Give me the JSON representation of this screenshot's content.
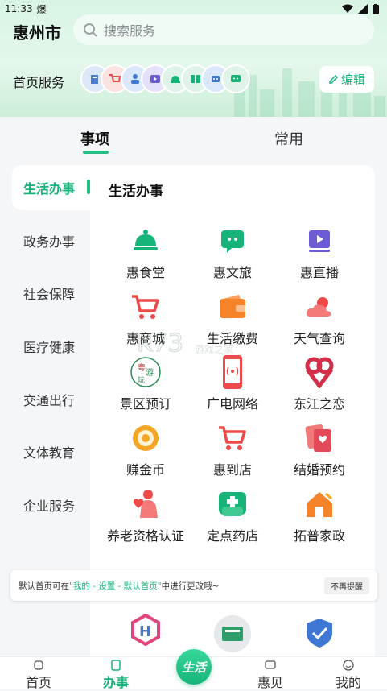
{
  "status": {
    "time": "11:33",
    "extra": "爆"
  },
  "header": {
    "city": "惠州市",
    "search_placeholder": "搜索服务",
    "home_services_label": "首页服务",
    "edit_label": "编辑"
  },
  "tabs": [
    {
      "label": "事项"
    },
    {
      "label": "常用"
    }
  ],
  "sidebar": [
    {
      "label": "生活办事"
    },
    {
      "label": "政务办事"
    },
    {
      "label": "社会保障"
    },
    {
      "label": "医疗健康"
    },
    {
      "label": "交通出行"
    },
    {
      "label": "文体教育"
    },
    {
      "label": "企业服务"
    }
  ],
  "panel": {
    "title": "生活办事"
  },
  "services": [
    {
      "label": "惠食堂",
      "icon": "dining-bell-icon"
    },
    {
      "label": "惠文旅",
      "icon": "chat-bubble-icon"
    },
    {
      "label": "惠直播",
      "icon": "play-icon"
    },
    {
      "label": "惠商城",
      "icon": "shopping-cart-icon"
    },
    {
      "label": "生活缴费",
      "icon": "wallet-icon"
    },
    {
      "label": "天气查询",
      "icon": "weather-icon"
    },
    {
      "label": "景区预订",
      "icon": "scenic-badge-icon"
    },
    {
      "label": "广电网络",
      "icon": "phone-signal-icon"
    },
    {
      "label": "东江之恋",
      "icon": "heart-ribbon-icon"
    },
    {
      "label": "赚金币",
      "icon": "coin-icon"
    },
    {
      "label": "惠到店",
      "icon": "store-cart-icon"
    },
    {
      "label": "结婚预约",
      "icon": "marriage-cert-icon"
    },
    {
      "label": "养老资格认证",
      "icon": "elder-heart-icon"
    },
    {
      "label": "定点药店",
      "icon": "pharmacy-icon"
    },
    {
      "label": "拓普家政",
      "icon": "house-clean-icon"
    }
  ],
  "toast": {
    "text_a": "默认首页可在",
    "text_highlight": "\"我的 - 设置 - 默认首页\"",
    "text_b": "中进行更改哦~",
    "dismiss": "不再提醒"
  },
  "nav": [
    {
      "label": "首页"
    },
    {
      "label": "办事"
    },
    {
      "label": "惠见"
    },
    {
      "label": "我的"
    }
  ],
  "center_button": {
    "label": "生活"
  },
  "watermark": {
    "text": "K73",
    "sub": "游戏之家"
  },
  "colors": {
    "accent": "#17b47a",
    "red": "#ef4a4a",
    "orange": "#f5832a",
    "purple": "#6b5cd6"
  }
}
